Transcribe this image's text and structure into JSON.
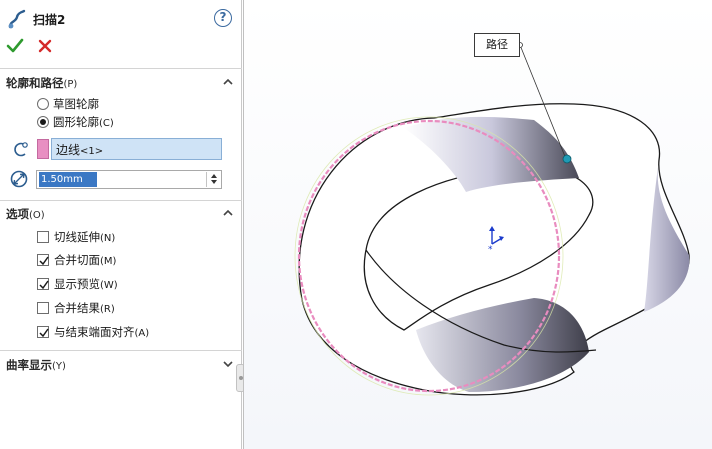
{
  "feature": {
    "title": "扫描2",
    "icon": "sweep-icon",
    "help_icon": "help-icon"
  },
  "actions": {
    "ok_icon": "checkmark-icon",
    "cancel_icon": "x-icon"
  },
  "profile_section": {
    "title": "轮廓和路径",
    "hotkey": "(P)",
    "options": [
      {
        "label": "草图轮廓",
        "hotkey": "",
        "selected": false
      },
      {
        "label": "圆形轮廓",
        "hotkey": "(C)",
        "selected": true
      }
    ],
    "path_selection": {
      "label": "边线",
      "sub": "<1>",
      "color": "#e88fc2"
    },
    "diameter": {
      "value": "1.50mm"
    }
  },
  "options_section": {
    "title": "选项",
    "hotkey": "(O)",
    "items": [
      {
        "label": "切线延伸",
        "hotkey": "(N)",
        "checked": false
      },
      {
        "label": "合并切面",
        "hotkey": "(M)",
        "checked": true
      },
      {
        "label": "显示预览",
        "hotkey": "(W)",
        "checked": true
      },
      {
        "label": "合并结果",
        "hotkey": "(R)",
        "checked": false
      },
      {
        "label": "与结束端面对齐",
        "hotkey": "(A)",
        "checked": true
      }
    ]
  },
  "curvature_section": {
    "title": "曲率显示",
    "hotkey": "(Y)"
  },
  "viewport": {
    "callout_label": "路径",
    "highlight_color": "#e98cbf",
    "accent_color": "#1f9bb5"
  }
}
